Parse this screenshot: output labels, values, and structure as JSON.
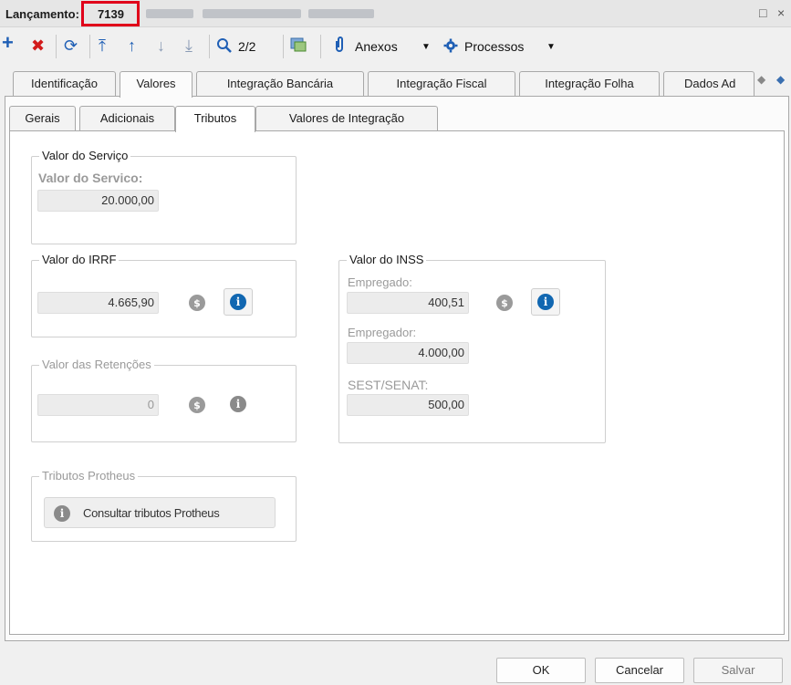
{
  "window": {
    "title_label": "Lançamento: ",
    "record_id": "7139",
    "minimize_glyph": "□",
    "close_glyph": "×"
  },
  "toolbar": {
    "add_icon": "+",
    "delete_icon": "✖",
    "refresh_icon": "⟳",
    "first_icon": "⤒",
    "prev_icon": "↑",
    "next_icon": "↓",
    "last_icon": "⤓",
    "search_icon": "🔍",
    "page_counter": "2/2",
    "anexos_label": "Anexos",
    "processos_label": "Processos"
  },
  "tabs_main": [
    {
      "label": "Identificação"
    },
    {
      "label": "Valores"
    },
    {
      "label": "Integração Bancária"
    },
    {
      "label": "Integração Fiscal"
    },
    {
      "label": "Integração Folha"
    },
    {
      "label": "Dados Ad"
    }
  ],
  "tabs_sub": [
    {
      "label": "Gerais"
    },
    {
      "label": "Adicionais"
    },
    {
      "label": "Tributos"
    },
    {
      "label": "Valores de Integração"
    }
  ],
  "valor_servico": {
    "group_title": "Valor do Serviço",
    "label": "Valor do Servico:",
    "value": "20.000,00"
  },
  "valor_irrf": {
    "group_title": "Valor do IRRF",
    "value": "4.665,90"
  },
  "valor_retencoes": {
    "group_title": "Valor das Retenções",
    "value": "0"
  },
  "valor_inss": {
    "group_title": "Valor do INSS",
    "empregado_label": "Empregado:",
    "empregado_value": "400,51",
    "empregador_label": "Empregador:",
    "empregador_value": "4.000,00",
    "sest_label": "SEST/SENAT:",
    "sest_value": "500,00"
  },
  "tributos_protheus": {
    "group_title": "Tributos Protheus",
    "button_label": "Consultar tributos Protheus"
  },
  "footer": {
    "ok_label": "OK",
    "cancel_label": "Cancelar",
    "save_label": "Salvar"
  },
  "colors": {
    "accent_blue": "#1167b1",
    "highlight_red": "#e0001a",
    "delete_red": "#d21b1b",
    "add_blue": "#1f5fb5"
  }
}
